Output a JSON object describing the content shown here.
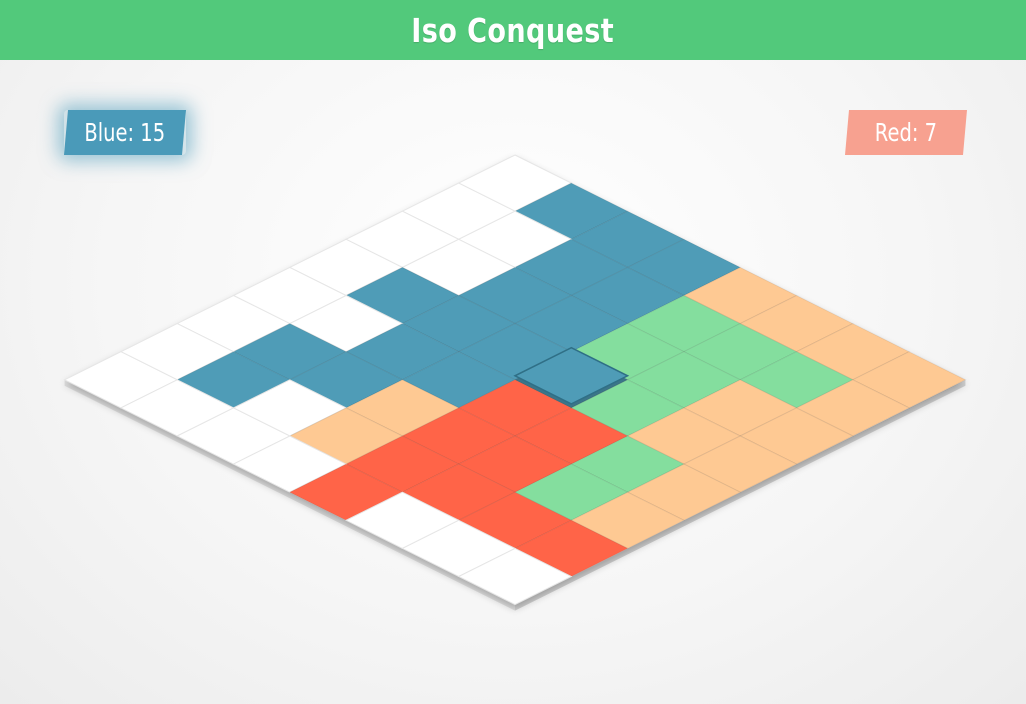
{
  "header": {
    "title": "Iso Conquest",
    "color": "#52c97b"
  },
  "scores": {
    "blue": {
      "label": "Blue: 15",
      "color": "#4a9ab9"
    },
    "red": {
      "label": "Red: 7",
      "color": "#f7a190"
    }
  },
  "board": {
    "size": 8,
    "colors": {
      "W": "#ffffff",
      "B": "#4f9cb7",
      "R": "#ff6448",
      "O": "#fec993",
      "G": "#84de9e"
    },
    "cells": [
      [
        "W",
        "B",
        "B",
        "B",
        "O",
        "O",
        "O",
        "O"
      ],
      [
        "W",
        "W",
        "B",
        "B",
        "G",
        "G",
        "G",
        "O"
      ],
      [
        "W",
        "W",
        "B",
        "B",
        "G",
        "G",
        "O",
        "O"
      ],
      [
        "W",
        "B",
        "B",
        "B",
        "B",
        "G",
        "O",
        "O"
      ],
      [
        "W",
        "W",
        "B",
        "B",
        "R",
        "R",
        "G",
        "O"
      ],
      [
        "W",
        "B",
        "B",
        "O",
        "R",
        "R",
        "G",
        "O"
      ],
      [
        "W",
        "B",
        "W",
        "O",
        "R",
        "R",
        "R",
        "R"
      ],
      [
        "W",
        "W",
        "W",
        "W",
        "R",
        "W",
        "W",
        "W"
      ]
    ],
    "selected": {
      "row": 3,
      "col": 4
    }
  }
}
